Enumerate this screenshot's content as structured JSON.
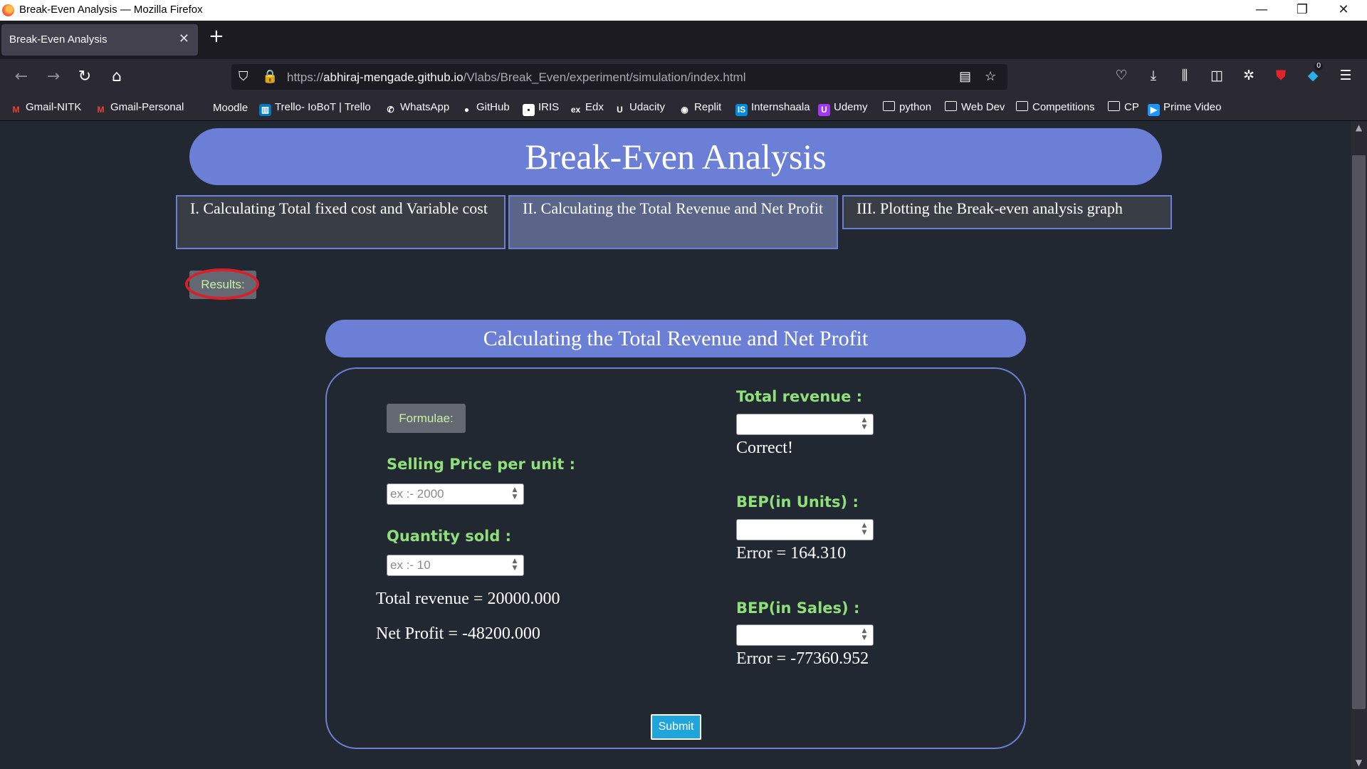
{
  "window": {
    "title": "Break-Even Analysis — Mozilla Firefox",
    "controls": {
      "minimize": "—",
      "restore": "❐",
      "close": "✕"
    }
  },
  "tabs": [
    {
      "label": "Break-Even Analysis",
      "close": "✕"
    }
  ],
  "new_tab_label": "+",
  "nav": {
    "url_prefix": "https://",
    "url_domain": "abhiraj-mengade.github.io",
    "url_path": "/Vlabs/Break_Even/experiment/simulation/index.html",
    "badge_count": "0"
  },
  "bookmarks": [
    {
      "label": "Gmail-NITK",
      "icon": "gmail-icon",
      "glyph": "M",
      "color": "#ea4335"
    },
    {
      "label": "Gmail-Personal",
      "icon": "gmail-icon",
      "glyph": "M",
      "color": "#ea4335"
    },
    {
      "label": "Moodle",
      "icon": "moodle-icon",
      "glyph": "",
      "color": "#2b2a33"
    },
    {
      "label": "Trello- IoBoT | Trello",
      "icon": "trello-icon",
      "glyph": "▥",
      "color": "#0079bf"
    },
    {
      "label": "WhatsApp",
      "icon": "whatsapp-icon",
      "glyph": "✆",
      "color": "#2b2a33"
    },
    {
      "label": "GitHub",
      "icon": "github-icon",
      "glyph": "●",
      "color": "#2b2a33"
    },
    {
      "label": "IRIS",
      "icon": "iris-icon",
      "glyph": "▪",
      "color": "#ffffff"
    },
    {
      "label": "Edx",
      "icon": "edx-icon",
      "glyph": "ex",
      "color": "#2b2a33"
    },
    {
      "label": "Udacity",
      "icon": "udacity-icon",
      "glyph": "U",
      "color": "#2b2a33"
    },
    {
      "label": "Replit",
      "icon": "replit-icon",
      "glyph": "◉",
      "color": "#2b2a33"
    },
    {
      "label": "Internshaala",
      "icon": "internshaala-icon",
      "glyph": "IS",
      "color": "#008bdc"
    },
    {
      "label": "Udemy",
      "icon": "udemy-icon",
      "glyph": "U",
      "color": "#a435f0"
    },
    {
      "label": "python",
      "icon": "folder-icon",
      "folder": true
    },
    {
      "label": "Web Dev",
      "icon": "folder-icon",
      "folder": true
    },
    {
      "label": "Competitions",
      "icon": "folder-icon",
      "folder": true
    },
    {
      "label": "CP",
      "icon": "folder-icon",
      "folder": true
    },
    {
      "label": "Prime Video",
      "icon": "prime-video-icon",
      "glyph": "▶",
      "color": "#1a98ff"
    }
  ],
  "page": {
    "title": "Break-Even Analysis",
    "steps": [
      {
        "label": "I. Calculating Total fixed cost and Variable cost",
        "active": false
      },
      {
        "label": "II. Calculating the Total Revenue and Net Profit",
        "active": true
      },
      {
        "label": "III. Plotting the Break-even analysis graph",
        "active": false
      }
    ],
    "results_label": "Results:",
    "section_title": "Calculating the Total Revenue and Net Profit",
    "formulae_label": "Formulae:",
    "left": {
      "selling_price_label": "Selling Price per unit :",
      "selling_price_placeholder": "ex :- 2000",
      "quantity_label": "Quantity sold :",
      "quantity_placeholder": "ex :- 10",
      "total_revenue_result": "Total revenue = 20000.000",
      "net_profit_result": "Net Profit = -48200.000"
    },
    "right": {
      "total_revenue_label": "Total revenue :",
      "total_revenue_feedback": "Correct!",
      "bep_units_label": "BEP(in Units) :",
      "bep_units_feedback": "Error = 164.310",
      "bep_sales_label": "BEP(in Sales) :",
      "bep_sales_feedback": "Error = -77360.952"
    },
    "submit_label": "Submit"
  },
  "colors": {
    "accent": "#6b7fd7",
    "label_green": "#8fe07a",
    "page_bg": "#222831",
    "highlight_ring": "#d81f2a",
    "submit": "#20a4dc"
  }
}
